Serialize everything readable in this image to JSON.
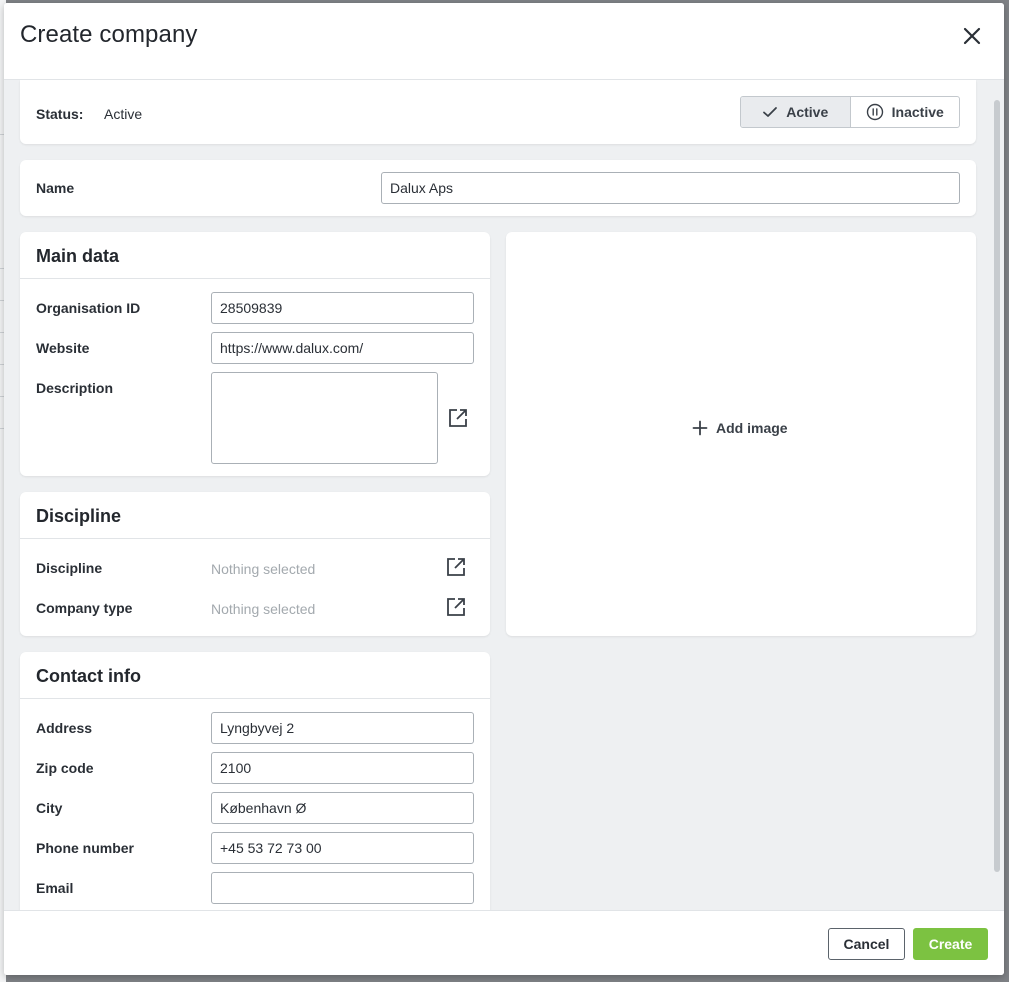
{
  "modal": {
    "title": "Create company",
    "close_icon": "close-icon"
  },
  "status": {
    "label": "Status:",
    "value": "Active",
    "options": [
      {
        "label": "Active",
        "icon": "check-icon",
        "selected": true
      },
      {
        "label": "Inactive",
        "icon": "pause-circle-icon",
        "selected": false
      }
    ]
  },
  "name": {
    "label": "Name",
    "value": "Dalux Aps"
  },
  "main_data": {
    "title": "Main data",
    "organisation_id": {
      "label": "Organisation ID",
      "value": "28509839"
    },
    "website": {
      "label": "Website",
      "value": "https://www.dalux.com/"
    },
    "description": {
      "label": "Description",
      "value": "",
      "icon": "open-external-icon"
    }
  },
  "discipline": {
    "title": "Discipline",
    "discipline": {
      "label": "Discipline",
      "value": "Nothing selected",
      "icon": "open-external-icon"
    },
    "company_type": {
      "label": "Company type",
      "value": "Nothing selected",
      "icon": "open-external-icon"
    }
  },
  "contact": {
    "title": "Contact info",
    "address": {
      "label": "Address",
      "value": "Lyngbyvej 2"
    },
    "zip": {
      "label": "Zip code",
      "value": "2100"
    },
    "city": {
      "label": "City",
      "value": "København Ø"
    },
    "phone": {
      "label": "Phone number",
      "value": "+45 53 72 73 00"
    },
    "email": {
      "label": "Email",
      "value": ""
    }
  },
  "image": {
    "add_label": "Add image",
    "icon": "plus-icon"
  },
  "footer": {
    "cancel_label": "Cancel",
    "create_label": "Create"
  },
  "colors": {
    "primary": "#7cc241",
    "background": "#eef0f2"
  }
}
